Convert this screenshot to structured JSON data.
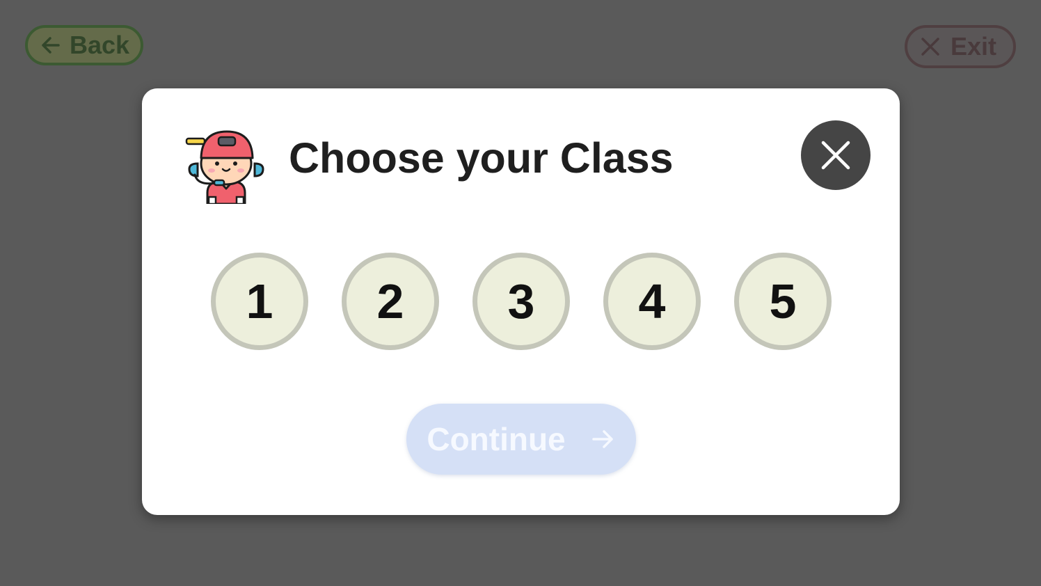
{
  "nav": {
    "back_label": "Back",
    "exit_label": "Exit"
  },
  "modal": {
    "title": "Choose your Class",
    "avatar_icon": "support-agent-avatar-icon",
    "close_icon": "close-icon",
    "class_options": [
      "1",
      "2",
      "3",
      "4",
      "5"
    ],
    "continue_label": "Continue",
    "continue_icon": "arrow-right-icon"
  },
  "colors": {
    "backdrop": "#5a5a5a",
    "modal_bg": "#ffffff",
    "close_button_bg": "#454545",
    "option_fill": "#edefdc",
    "option_border": "#c4c6b9",
    "continue_disabled_bg": "#d5e0f6"
  }
}
